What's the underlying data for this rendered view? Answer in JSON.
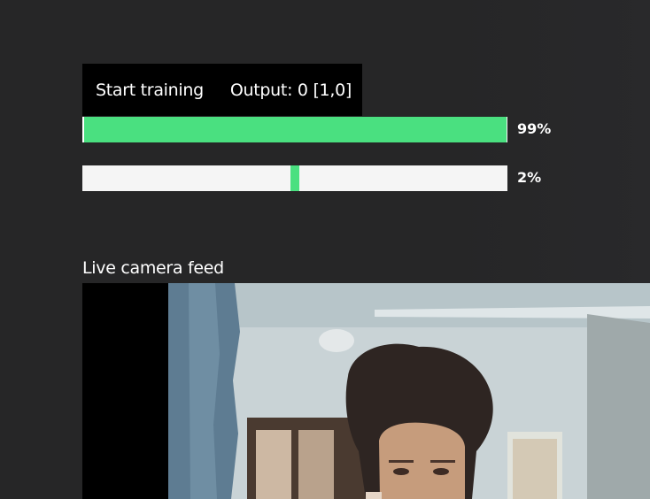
{
  "toolbar": {
    "start_training_label": "Start training",
    "output_text": "Output: 0 [1,0]"
  },
  "classes": [
    {
      "percent_label": "99%",
      "confidence": 0.99
    },
    {
      "percent_label": "2%",
      "confidence": 0.02
    }
  ],
  "camera": {
    "label": "Live camera feed"
  },
  "colors": {
    "background": "#262627",
    "bar_fill": "#4ae080",
    "bar_track": "#f5f5f5",
    "toolbar_bg": "#000000"
  }
}
